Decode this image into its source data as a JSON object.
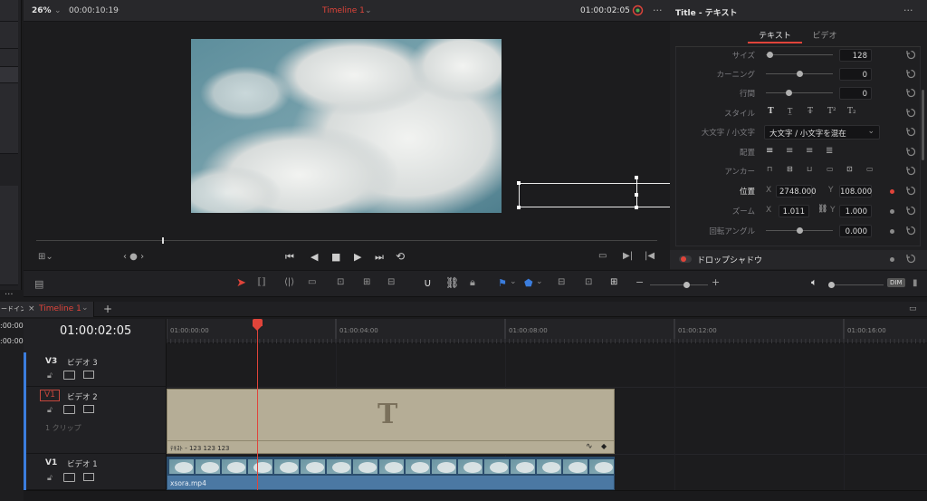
{
  "viewer": {
    "zoom": "26%",
    "duration": "00:00:10:19",
    "timeline_name": "Timeline 1",
    "timecode": "01:00:02:05"
  },
  "inspector": {
    "title": "Title - テキスト",
    "tabs": [
      "テキスト",
      "ビデオ"
    ],
    "size_label": "サイズ",
    "size_value": "128",
    "kerning_label": "カーニング",
    "kerning_value": "0",
    "linespacing_label": "行間",
    "linespacing_value": "0",
    "style_label": "スタイル",
    "case_label": "大文字 / 小文字",
    "case_value": "大文字 / 小文字を混在",
    "align_label": "配置",
    "anchor_label": "アンカー",
    "position_label": "位置",
    "pos_x_label": "X",
    "pos_x": "2748.000",
    "pos_y_label": "Y",
    "pos_y": "108.000",
    "zoom_label": "ズーム",
    "zoom_x_label": "X",
    "zoom_x": "1.011",
    "zoom_y_label": "Y",
    "zoom_y": "1.000",
    "rotation_label": "回転アングル",
    "rotation_value": "0.000",
    "dropshadow_label": "ドロップシャドウ"
  },
  "left_strip": {
    "tab_label": "ードイン",
    "timecode_1": ":00:00",
    "timecode_2": ":00:00"
  },
  "timeline": {
    "tab_label": "Timeline 1",
    "timecode": "01:00:02:05",
    "ruler": [
      "01:00:00:00",
      "01:00:04:00",
      "01:00:08:00",
      "01:00:12:00",
      "01:00:16:00"
    ],
    "tracks": [
      {
        "id": "V3",
        "name": "ビデオ 3",
        "clips_label": ""
      },
      {
        "id": "V1",
        "name": "ビデオ 2",
        "clips_label": "1 クリップ"
      },
      {
        "id": "V1",
        "name": "ビデオ 1",
        "clips_label": ""
      }
    ],
    "title_clip_label": "ﾃｷｽﾄ - 123  123  123",
    "title_clip_glyph": "T",
    "video_clip_label": "xsora.mp4",
    "dim_label": "DIM"
  },
  "colors": {
    "accent_red": "#e0443a",
    "title_clip": "#b5ad96",
    "video_clip": "#4b78a3",
    "panel_dark": "#1c1c1e"
  }
}
